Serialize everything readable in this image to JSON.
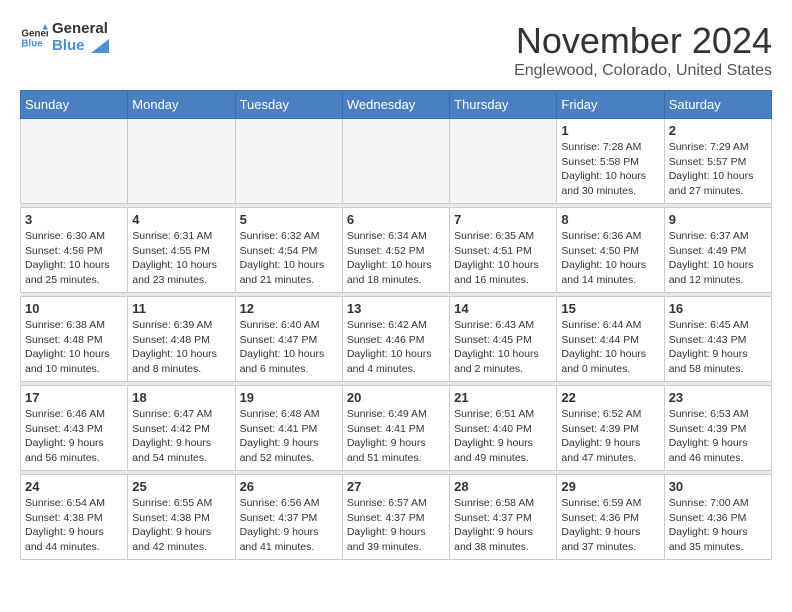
{
  "logo": {
    "general": "General",
    "blue": "Blue"
  },
  "title": {
    "month": "November 2024",
    "location": "Englewood, Colorado, United States"
  },
  "weekdays": [
    "Sunday",
    "Monday",
    "Tuesday",
    "Wednesday",
    "Thursday",
    "Friday",
    "Saturday"
  ],
  "weeks": [
    [
      {
        "day": "",
        "info": ""
      },
      {
        "day": "",
        "info": ""
      },
      {
        "day": "",
        "info": ""
      },
      {
        "day": "",
        "info": ""
      },
      {
        "day": "",
        "info": ""
      },
      {
        "day": "1",
        "info": "Sunrise: 7:28 AM\nSunset: 5:58 PM\nDaylight: 10 hours and 30 minutes."
      },
      {
        "day": "2",
        "info": "Sunrise: 7:29 AM\nSunset: 5:57 PM\nDaylight: 10 hours and 27 minutes."
      }
    ],
    [
      {
        "day": "3",
        "info": "Sunrise: 6:30 AM\nSunset: 4:56 PM\nDaylight: 10 hours and 25 minutes."
      },
      {
        "day": "4",
        "info": "Sunrise: 6:31 AM\nSunset: 4:55 PM\nDaylight: 10 hours and 23 minutes."
      },
      {
        "day": "5",
        "info": "Sunrise: 6:32 AM\nSunset: 4:54 PM\nDaylight: 10 hours and 21 minutes."
      },
      {
        "day": "6",
        "info": "Sunrise: 6:34 AM\nSunset: 4:52 PM\nDaylight: 10 hours and 18 minutes."
      },
      {
        "day": "7",
        "info": "Sunrise: 6:35 AM\nSunset: 4:51 PM\nDaylight: 10 hours and 16 minutes."
      },
      {
        "day": "8",
        "info": "Sunrise: 6:36 AM\nSunset: 4:50 PM\nDaylight: 10 hours and 14 minutes."
      },
      {
        "day": "9",
        "info": "Sunrise: 6:37 AM\nSunset: 4:49 PM\nDaylight: 10 hours and 12 minutes."
      }
    ],
    [
      {
        "day": "10",
        "info": "Sunrise: 6:38 AM\nSunset: 4:48 PM\nDaylight: 10 hours and 10 minutes."
      },
      {
        "day": "11",
        "info": "Sunrise: 6:39 AM\nSunset: 4:48 PM\nDaylight: 10 hours and 8 minutes."
      },
      {
        "day": "12",
        "info": "Sunrise: 6:40 AM\nSunset: 4:47 PM\nDaylight: 10 hours and 6 minutes."
      },
      {
        "day": "13",
        "info": "Sunrise: 6:42 AM\nSunset: 4:46 PM\nDaylight: 10 hours and 4 minutes."
      },
      {
        "day": "14",
        "info": "Sunrise: 6:43 AM\nSunset: 4:45 PM\nDaylight: 10 hours and 2 minutes."
      },
      {
        "day": "15",
        "info": "Sunrise: 6:44 AM\nSunset: 4:44 PM\nDaylight: 10 hours and 0 minutes."
      },
      {
        "day": "16",
        "info": "Sunrise: 6:45 AM\nSunset: 4:43 PM\nDaylight: 9 hours and 58 minutes."
      }
    ],
    [
      {
        "day": "17",
        "info": "Sunrise: 6:46 AM\nSunset: 4:43 PM\nDaylight: 9 hours and 56 minutes."
      },
      {
        "day": "18",
        "info": "Sunrise: 6:47 AM\nSunset: 4:42 PM\nDaylight: 9 hours and 54 minutes."
      },
      {
        "day": "19",
        "info": "Sunrise: 6:48 AM\nSunset: 4:41 PM\nDaylight: 9 hours and 52 minutes."
      },
      {
        "day": "20",
        "info": "Sunrise: 6:49 AM\nSunset: 4:41 PM\nDaylight: 9 hours and 51 minutes."
      },
      {
        "day": "21",
        "info": "Sunrise: 6:51 AM\nSunset: 4:40 PM\nDaylight: 9 hours and 49 minutes."
      },
      {
        "day": "22",
        "info": "Sunrise: 6:52 AM\nSunset: 4:39 PM\nDaylight: 9 hours and 47 minutes."
      },
      {
        "day": "23",
        "info": "Sunrise: 6:53 AM\nSunset: 4:39 PM\nDaylight: 9 hours and 46 minutes."
      }
    ],
    [
      {
        "day": "24",
        "info": "Sunrise: 6:54 AM\nSunset: 4:38 PM\nDaylight: 9 hours and 44 minutes."
      },
      {
        "day": "25",
        "info": "Sunrise: 6:55 AM\nSunset: 4:38 PM\nDaylight: 9 hours and 42 minutes."
      },
      {
        "day": "26",
        "info": "Sunrise: 6:56 AM\nSunset: 4:37 PM\nDaylight: 9 hours and 41 minutes."
      },
      {
        "day": "27",
        "info": "Sunrise: 6:57 AM\nSunset: 4:37 PM\nDaylight: 9 hours and 39 minutes."
      },
      {
        "day": "28",
        "info": "Sunrise: 6:58 AM\nSunset: 4:37 PM\nDaylight: 9 hours and 38 minutes."
      },
      {
        "day": "29",
        "info": "Sunrise: 6:59 AM\nSunset: 4:36 PM\nDaylight: 9 hours and 37 minutes."
      },
      {
        "day": "30",
        "info": "Sunrise: 7:00 AM\nSunset: 4:36 PM\nDaylight: 9 hours and 35 minutes."
      }
    ]
  ]
}
